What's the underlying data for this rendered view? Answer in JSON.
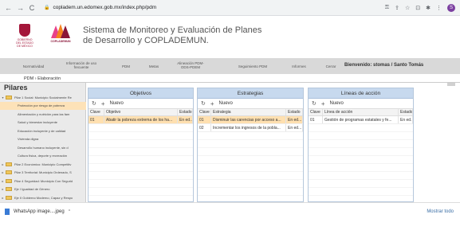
{
  "browser": {
    "url": "copladem.un.edomex.gob.mx/index.php/pdm",
    "back": "←",
    "forward": "→",
    "reload": "C"
  },
  "header": {
    "title_line1": "Sistema de Monitoreo y Evaluación de Planes",
    "title_line2": "de Desarrollo y COPLADEMUN.",
    "logo1_text": "GOBIERNO DEL ESTADO DE MÉXICO",
    "logo2_text": "COPLADEMUN"
  },
  "menu": {
    "items": [
      "Normatividad",
      "Información de uso frecuente",
      "PDM",
      "Metas",
      "Alineación PDM-ODS-PDEM",
      "Seguimiento PDM",
      "Informes",
      "Cerrar"
    ],
    "welcome": "Bienvenido: stomas / Santo Tomás"
  },
  "breadcrumb": "PDM › Elaboración",
  "tree": {
    "heading": "Pilares",
    "nodes": [
      {
        "label": "Pilar 1 Social: Municipio Socialmente Re",
        "level": 0,
        "expand": "▾",
        "selected": false
      },
      {
        "label": "Protección por riesgo de pobreza",
        "level": 1,
        "expand": "",
        "selected": true
      },
      {
        "label": "Alimentación y nutrición para las fam",
        "level": 1,
        "expand": "",
        "selected": false
      },
      {
        "label": "Salud y bienestar incluyente",
        "level": 1,
        "expand": "",
        "selected": false
      },
      {
        "label": "Educación incluyente y de calidad",
        "level": 1,
        "expand": "",
        "selected": false
      },
      {
        "label": "Vivienda digna",
        "level": 1,
        "expand": "",
        "selected": false
      },
      {
        "label": "Desarrollo humano incluyente, sin d",
        "level": 1,
        "expand": "",
        "selected": false
      },
      {
        "label": "Cultura física, deporte y recreación",
        "level": 1,
        "expand": "",
        "selected": false
      },
      {
        "label": "Pilar 2 Económico: Municipio Competitiv",
        "level": 0,
        "expand": "▸",
        "selected": false
      },
      {
        "label": "Pilar 3 Territorial: Municipio Ordenado, S",
        "level": 0,
        "expand": "▸",
        "selected": false
      },
      {
        "label": "Pilar 4 Seguridad: Municipio Con Segurid",
        "level": 0,
        "expand": "▸",
        "selected": false
      },
      {
        "label": "Eje I Igualdad de Género",
        "level": 0,
        "expand": "▸",
        "selected": false
      },
      {
        "label": "Eje II Gobierno Moderno, Capaz y Respo",
        "level": 0,
        "expand": "▸",
        "selected": false
      }
    ]
  },
  "panels": {
    "objetivos": {
      "title": "Objetivos",
      "new_label": "Nuevo",
      "headers": [
        "Clave",
        "Objetivo",
        "Estado"
      ],
      "rows": [
        [
          "01",
          "Abatir la pobreza extrema de los ha...",
          "En ed..."
        ]
      ]
    },
    "estrategias": {
      "title": "Estrategias",
      "new_label": "Nuevo",
      "headers": [
        "Clave",
        "Estrategia",
        "Estado"
      ],
      "rows": [
        [
          "01",
          "Disminuir las carencias por acceso a...",
          "En ed..."
        ],
        [
          "02",
          "Incrementar los ingresos de la pobla...",
          "En ed..."
        ]
      ]
    },
    "lineas": {
      "title": "Líneas de acción",
      "new_label": "Nuevo",
      "headers": [
        "Clave",
        "Línea de acción",
        "Estado"
      ],
      "rows": [
        [
          "01",
          "Gestión de programas estatales y fe...",
          "En ed..."
        ]
      ]
    }
  },
  "downloads": {
    "file": "WhatsApp image....jpeg",
    "show_all": "Mostrar todo"
  }
}
